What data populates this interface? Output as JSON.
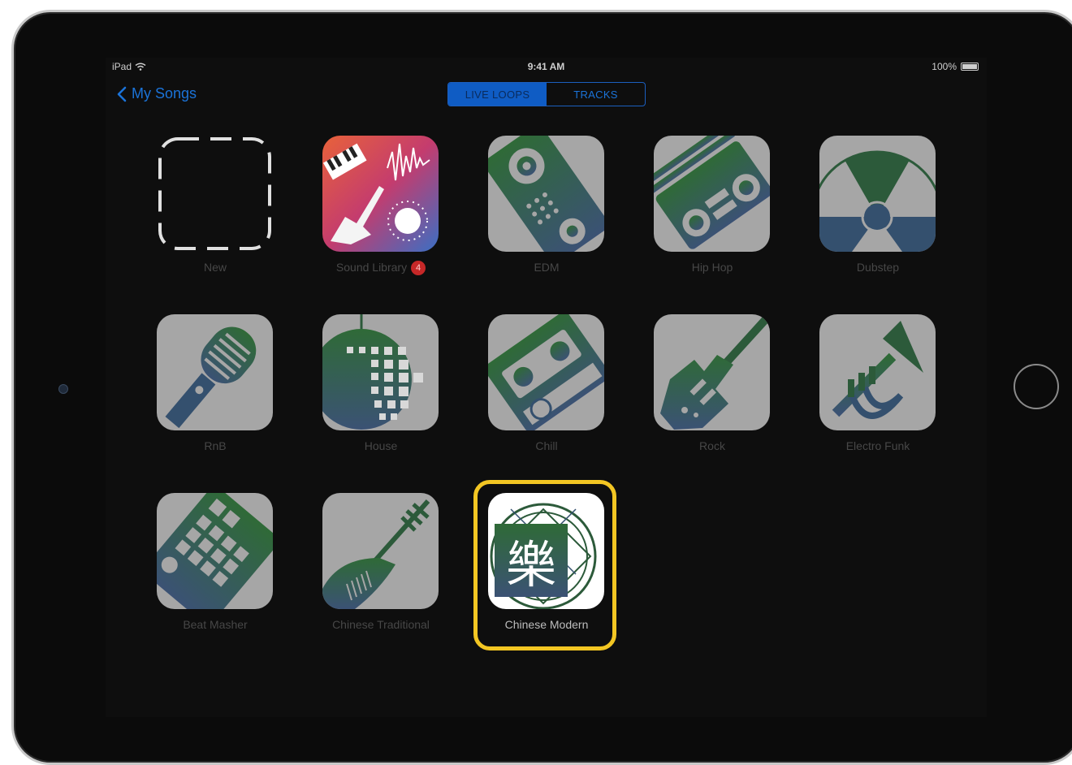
{
  "status": {
    "device": "iPad",
    "time": "9:41 AM",
    "battery": "100%"
  },
  "nav": {
    "back_label": "My Songs"
  },
  "segmented": {
    "tabs": [
      {
        "label": "LIVE LOOPS",
        "active": true
      },
      {
        "label": "TRACKS",
        "active": false
      }
    ]
  },
  "templates": [
    {
      "label": "New"
    },
    {
      "label": "Sound Library",
      "badge": "4"
    },
    {
      "label": "EDM"
    },
    {
      "label": "Hip Hop"
    },
    {
      "label": "Dubstep"
    },
    {
      "label": "RnB"
    },
    {
      "label": "House"
    },
    {
      "label": "Chill"
    },
    {
      "label": "Rock"
    },
    {
      "label": "Electro Funk"
    },
    {
      "label": "Beat Masher"
    },
    {
      "label": "Chinese Traditional"
    },
    {
      "label": "Chinese Modern",
      "selected": true,
      "glyph": "樂"
    }
  ],
  "colors": {
    "accent": "#1b73d8",
    "highlight": "#f3c623",
    "badge": "#c62828",
    "icon_green": "#2c5a3a",
    "icon_blue": "#34506e"
  }
}
